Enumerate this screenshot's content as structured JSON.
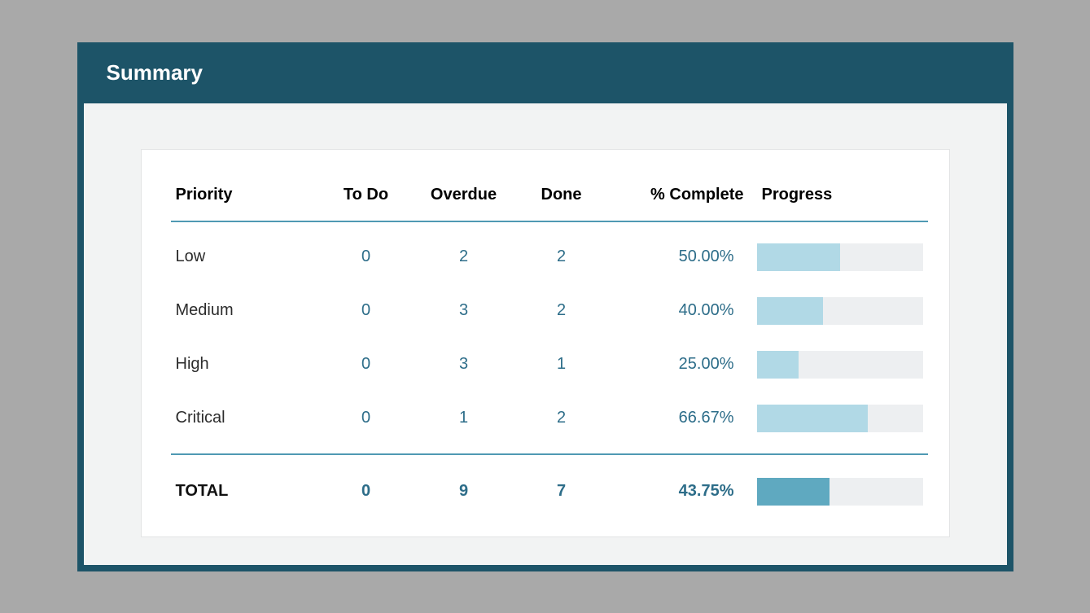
{
  "header": {
    "title": "Summary"
  },
  "columns": {
    "priority": "Priority",
    "todo": "To Do",
    "overdue": "Overdue",
    "done": "Done",
    "pct": "% Complete",
    "progress": "Progress"
  },
  "rows": [
    {
      "priority": "Low",
      "todo": "0",
      "overdue": "2",
      "done": "2",
      "pct": "50.00%"
    },
    {
      "priority": "Medium",
      "todo": "0",
      "overdue": "3",
      "done": "2",
      "pct": "40.00%"
    },
    {
      "priority": "High",
      "todo": "0",
      "overdue": "3",
      "done": "1",
      "pct": "25.00%"
    },
    {
      "priority": "Critical",
      "todo": "0",
      "overdue": "1",
      "done": "2",
      "pct": "66.67%"
    }
  ],
  "total": {
    "label": "TOTAL",
    "todo": "0",
    "overdue": "9",
    "done": "7",
    "pct": "43.75%"
  },
  "chart_data": {
    "type": "table",
    "title": "Summary",
    "columns": [
      "Priority",
      "To Do",
      "Overdue",
      "Done",
      "% Complete"
    ],
    "series": [
      {
        "priority": "Low",
        "todo": 0,
        "overdue": 2,
        "done": 2,
        "pct_complete": 50.0
      },
      {
        "priority": "Medium",
        "todo": 0,
        "overdue": 3,
        "done": 2,
        "pct_complete": 40.0
      },
      {
        "priority": "High",
        "todo": 0,
        "overdue": 3,
        "done": 1,
        "pct_complete": 25.0
      },
      {
        "priority": "Critical",
        "todo": 0,
        "overdue": 1,
        "done": 2,
        "pct_complete": 66.67
      }
    ],
    "total": {
      "todo": 0,
      "overdue": 9,
      "done": 7,
      "pct_complete": 43.75
    },
    "progress_range": [
      0,
      100
    ]
  }
}
